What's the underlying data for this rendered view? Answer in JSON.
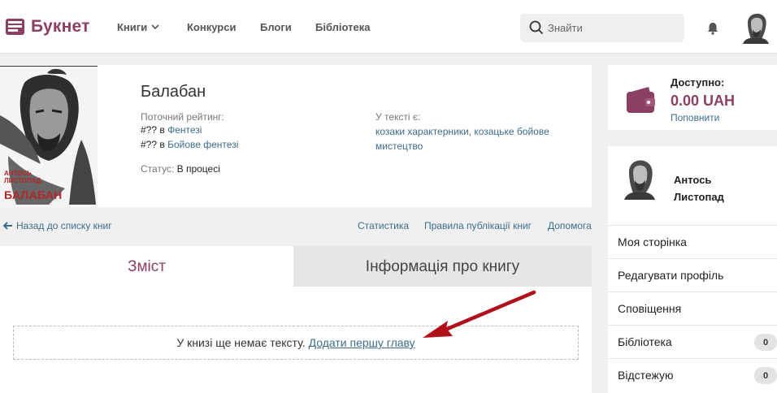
{
  "header": {
    "logo_text": "Букнет",
    "nav": {
      "books": "Книги",
      "contests": "Конкурси",
      "blogs": "Блоги",
      "library": "Бібліотека"
    },
    "search_placeholder": "Знайти"
  },
  "book": {
    "cover_author": "АНТОСЬ ЛИСТОПАД",
    "cover_title": "БАЛАБАН",
    "title": "Балабан",
    "rating_label": "Поточний рейтинг:",
    "rating_1_prefix": "#?? в",
    "rating_1_genre": "Фентезі",
    "rating_2_prefix": "#?? в",
    "rating_2_genre": "Бойове фентезі",
    "status_label": "Статус:",
    "status_value": "В процесі",
    "tags_label": "У тексті є:",
    "tags": "козаки характерники, козацьке бойове мистецтво"
  },
  "links": {
    "back": "Назад до списку книг",
    "stats": "Статистика",
    "rules": "Правила публікації книг",
    "help": "Допомога"
  },
  "tabs": {
    "contents": "Зміст",
    "info": "Інформація про книгу"
  },
  "content": {
    "empty_text": "У книзі ще немає тексту.",
    "add_chapter": "Додати першу главу"
  },
  "wallet": {
    "label": "Доступно:",
    "amount": "0.00 UAH",
    "topup": "Поповнити"
  },
  "profile": {
    "name": "Антось Листопад",
    "menu": [
      {
        "label": "Моя сторінка"
      },
      {
        "label": "Редагувати профіль"
      },
      {
        "label": "Сповіщення"
      },
      {
        "label": "Бібліотека",
        "badge": "0"
      },
      {
        "label": "Відстежую",
        "badge": "0"
      }
    ]
  }
}
